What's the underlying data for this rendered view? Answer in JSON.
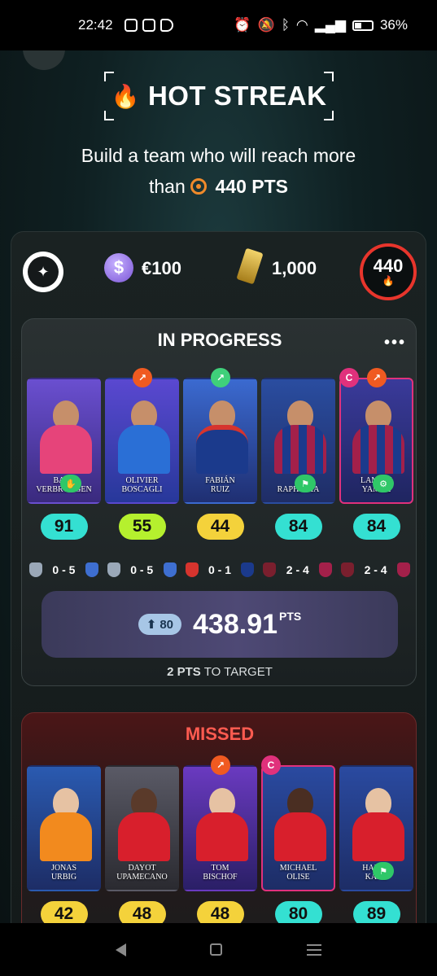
{
  "status": {
    "time": "22:42",
    "battery": "36%"
  },
  "header": {
    "title": "HOT STREAK",
    "subtitle_line1": "Build a team who will reach more",
    "subtitle_than": "than",
    "target": "440 PTS"
  },
  "info": {
    "budget": "€100",
    "reward": "1,000",
    "ring_score": "440"
  },
  "in_progress": {
    "title": "IN PROGRESS",
    "players": [
      {
        "name1": "BART",
        "name2": "VERBRUGGEN",
        "score": "91",
        "pill": "cyan",
        "kit": "#e6447a",
        "art": "#4c2f8e"
      },
      {
        "name1": "OLIVIER",
        "name2": "BOSCAGLI",
        "score": "55",
        "pill": "lime",
        "kit": "#2a6fd6",
        "art": "#27389a"
      },
      {
        "name1": "FABIÁN",
        "name2": "RUIZ",
        "score": "44",
        "pill": "yellow",
        "kit": "#e8eef5",
        "art": "#2a4d9a"
      },
      {
        "name1": "RAPHINHA",
        "name2": "",
        "score": "84",
        "pill": "cyan",
        "kit": "#a3204a",
        "art": "#1f3a86"
      },
      {
        "name1": "LAMINE",
        "name2": "YAMAL",
        "score": "84",
        "pill": "cyan",
        "kit": "#a3204a",
        "art": "#2a2f7a"
      }
    ],
    "fixtures": [
      {
        "score": "0 - 5",
        "home": "#9aa8b8",
        "away": "#3e6fd1"
      },
      {
        "score": "0 - 5",
        "home": "#9aa8b8",
        "away": "#3e6fd1"
      },
      {
        "score": "0 - 1",
        "home": "#d6342e",
        "away": "#1b3a8c"
      },
      {
        "score": "2 - 4",
        "home": "#7a1f2e",
        "away": "#a3204a"
      },
      {
        "score": "2 - 4",
        "home": "#7a1f2e",
        "away": "#a3204a"
      }
    ],
    "boost": "80",
    "total": "438.91",
    "total_unit": "PTS",
    "to_target_value": "2 PTS",
    "to_target_text": "TO TARGET"
  },
  "missed": {
    "title": "MISSED",
    "players": [
      {
        "name1": "JONAS",
        "name2": "URBIG",
        "score": "42",
        "pill": "yellow",
        "kit": "#f28a1e",
        "art": "#1d3b86"
      },
      {
        "name1": "DAYOT",
        "name2": "UPAMECANO",
        "score": "48",
        "pill": "yellow",
        "kit": "#d81f2c",
        "art": "#3a3a44"
      },
      {
        "name1": "TOM",
        "name2": "BISCHOF",
        "score": "48",
        "pill": "yellow",
        "kit": "#d81f2c",
        "art": "#4a2a8a"
      },
      {
        "name1": "MICHAEL",
        "name2": "OLISE",
        "score": "80",
        "pill": "cyan",
        "kit": "#d81f2c",
        "art": "#1d3b86"
      },
      {
        "name1": "HARRY",
        "name2": "KANE",
        "score": "89",
        "pill": "cyan",
        "kit": "#d81f2c",
        "art": "#1d3b86"
      }
    ]
  }
}
